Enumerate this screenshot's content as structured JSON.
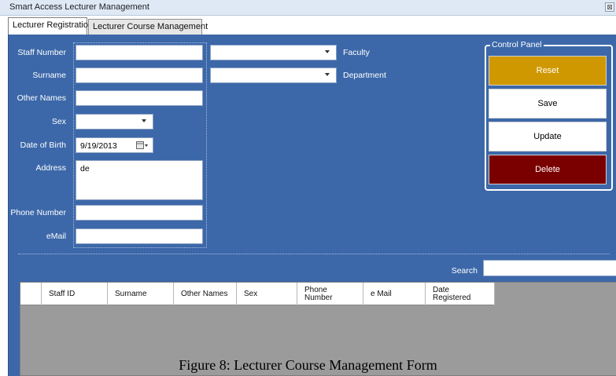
{
  "window": {
    "title": "Smart Access Lecturer Management",
    "close_label": "⊠"
  },
  "tabs": [
    {
      "label": "Lecturer Registration",
      "active": true
    },
    {
      "label": "Lecturer Course Management",
      "active": false
    }
  ],
  "form": {
    "staff_number": {
      "label": "Staff Number",
      "value": ""
    },
    "surname": {
      "label": "Surname",
      "value": ""
    },
    "other_names": {
      "label": "Other Names",
      "value": ""
    },
    "sex": {
      "label": "Sex",
      "value": ""
    },
    "date_of_birth": {
      "label": "Date of Birth",
      "value": "9/19/2013"
    },
    "address": {
      "label": "Address",
      "value": "de"
    },
    "phone_number": {
      "label": "Phone Number",
      "value": ""
    },
    "email": {
      "label": "eMail",
      "value": ""
    },
    "faculty": {
      "label": "Faculty",
      "value": ""
    },
    "department": {
      "label": "Department",
      "value": ""
    }
  },
  "control_panel": {
    "title": "Control Panel",
    "reset": "Reset",
    "save": "Save",
    "update": "Update",
    "delete": "Delete"
  },
  "search": {
    "label": "Search",
    "value": ""
  },
  "table": {
    "columns": [
      "Staff ID",
      "Surname",
      "Other Names",
      "Sex",
      "Phone Number",
      "e Mail",
      "Date Registered"
    ],
    "rows": []
  },
  "caption": "Figure 8: Lecturer Course Management Form",
  "colors": {
    "form_background": "#3c68a9",
    "reset_button": "#cf9800",
    "delete_button": "#7a0000",
    "grid_background": "#9b9b9b"
  }
}
